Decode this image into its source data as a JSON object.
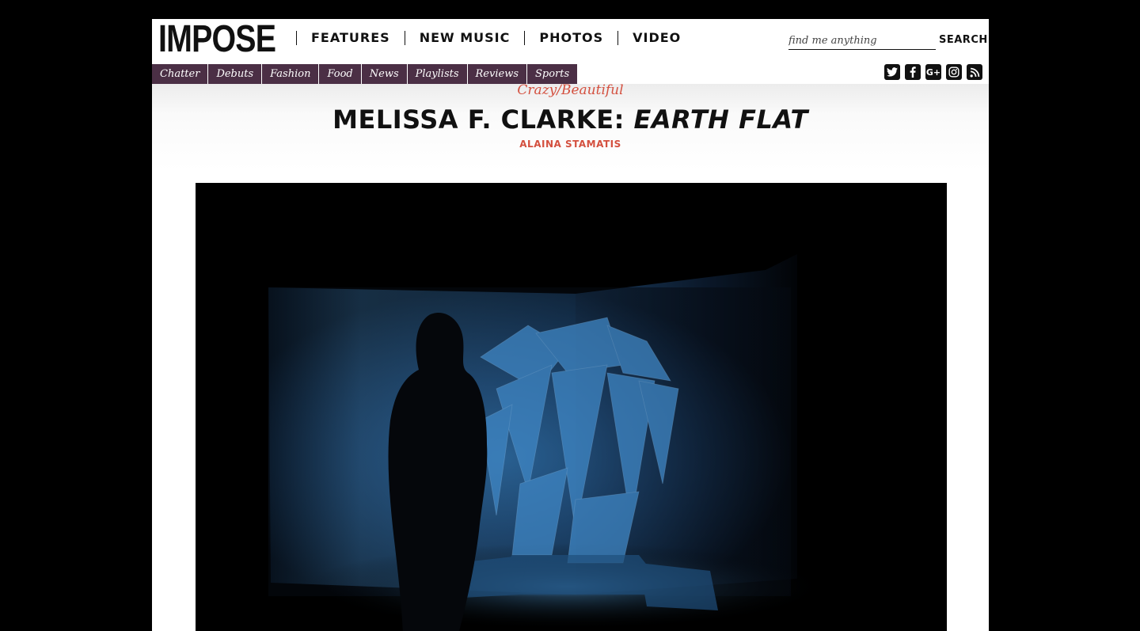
{
  "site": {
    "logo": "IMPOSE"
  },
  "main_nav": [
    "FEATURES",
    "NEW MUSIC",
    "PHOTOS",
    "VIDEO"
  ],
  "search": {
    "placeholder": "find me anything",
    "button": "SEARCH"
  },
  "sub_nav": [
    "Chatter",
    "Debuts",
    "Fashion",
    "Food",
    "News",
    "Playlists",
    "Reviews",
    "Sports"
  ],
  "social_icons": [
    "twitter-icon",
    "facebook-icon",
    "google-plus-icon",
    "instagram-icon",
    "rss-icon"
  ],
  "article": {
    "kicker": "Crazy/Beautiful",
    "title_plain": "MELISSA F. CLARKE: ",
    "title_italic": "EARTH FLAT",
    "author": "ALAINA STAMATIS"
  },
  "colors": {
    "accent": "#d4503f",
    "subnav_bg": "#4b2f45",
    "page_bg": "#000000"
  }
}
